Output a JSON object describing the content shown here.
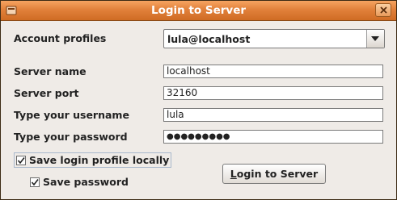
{
  "window": {
    "title": "Login to Server"
  },
  "profiles": {
    "label": "Account profiles",
    "selected": "lula@localhost"
  },
  "form": {
    "server_name_label": "Server name",
    "server_name_value": "localhost",
    "server_port_label": "Server port",
    "server_port_value": "32160",
    "username_label": "Type your username",
    "username_value": "lula",
    "password_label": "Type your password",
    "password_value": "●●●●●●●●●"
  },
  "options": {
    "save_profile_label": "Save login profile locally",
    "save_profile_checked": true,
    "save_password_label": "Save password",
    "save_password_checked": true
  },
  "actions": {
    "login_label": "Login to Server"
  }
}
